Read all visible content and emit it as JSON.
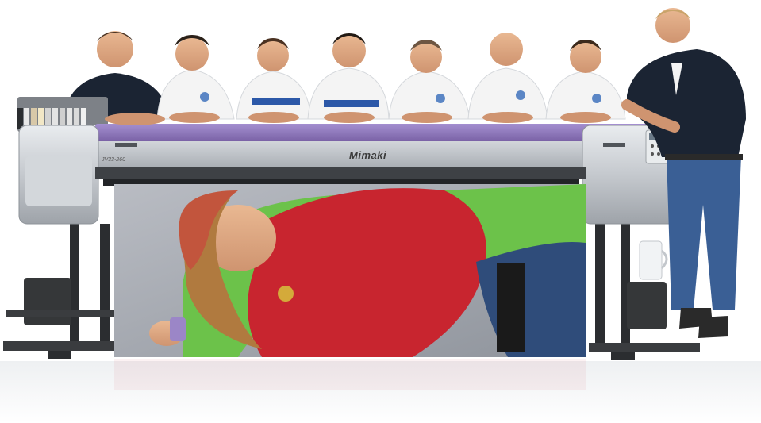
{
  "scene": {
    "brand_label": "Mimaki",
    "model_label": "JV33-260",
    "colors": {
      "background": "#ffffff",
      "printer_body": "#c9cdd1",
      "printer_purple": "#8e77b8",
      "polo_white": "#f4f4f4",
      "polo_navy": "#1b2433",
      "print_red": "#c8252f",
      "print_green": "#6cc24a"
    },
    "people_count": 8,
    "icons": [
      "printer",
      "ink-cartridges",
      "control-panel",
      "person",
      "mug"
    ]
  }
}
